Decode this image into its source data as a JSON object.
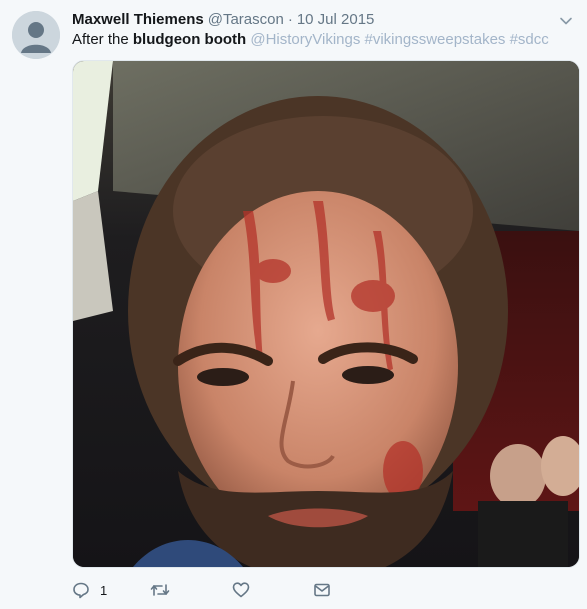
{
  "tweet": {
    "author_name": "Maxwell Thiemens",
    "handle": "@Tarascon",
    "separator": "·",
    "date": "10 Jul 2015",
    "text_parts": {
      "plain": "After the ",
      "bold": "bludgeon booth",
      "links": "@HistoryVikings #vikingssweepstakes #sdcc"
    },
    "avatar_icon": "default-profile-icon",
    "media_icon": "photo",
    "actions": {
      "reply_icon": "reply-icon",
      "reply_count": "1",
      "retweet_icon": "retweet-icon",
      "like_icon": "heart-icon",
      "dm_icon": "mail-icon"
    },
    "colors": {
      "link": "#a3b5c9",
      "muted": "#657786",
      "background": "#f5f8fa"
    }
  }
}
